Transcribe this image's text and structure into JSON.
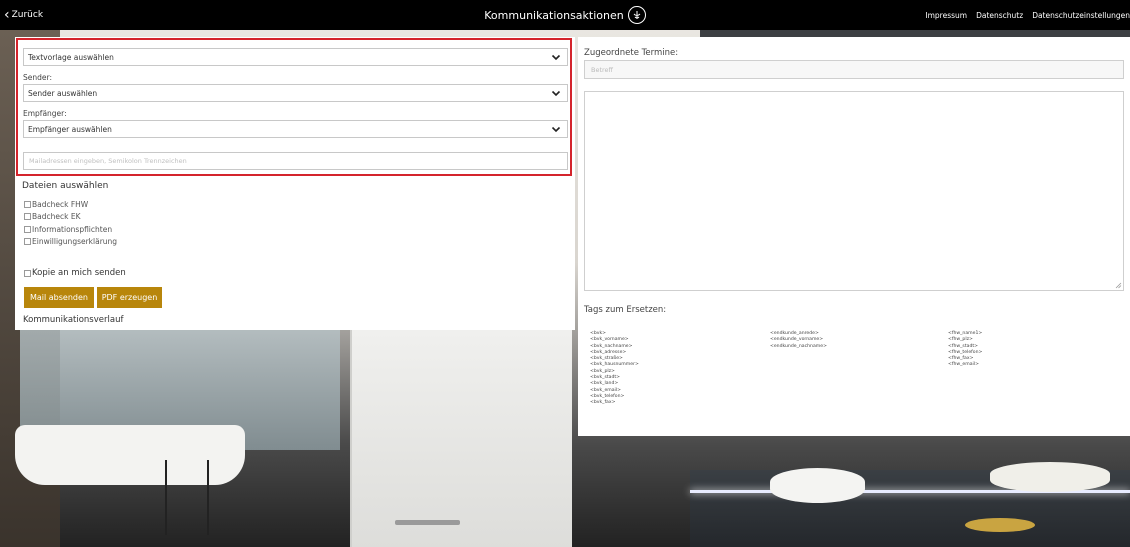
{
  "topbar": {
    "back_label": "Zurück",
    "title": "Kommunikationsaktionen",
    "links": [
      "Impressum",
      "Datenschutz",
      "Datenschutzeinstellungen"
    ]
  },
  "form": {
    "template_select": "Textvorlage auswählen",
    "sender_label": "Sender:",
    "sender_select": "Sender auswählen",
    "recipient_label": "Empfänger:",
    "recipient_select": "Empfänger auswählen",
    "email_placeholder": "Mailadressen eingeben, Semikolon Trennzeichen",
    "files_title": "Dateien auswählen",
    "files": [
      "Badcheck FHW",
      "Badcheck EK",
      "Informationspflichten",
      "Einwilligungserklärung"
    ],
    "copy_label": "Kopie an mich senden",
    "send_button": "Mail absenden",
    "pdf_button": "PDF erzeugen",
    "history_label": "Kommunikationsverlauf"
  },
  "right": {
    "appointments_label": "Zugeordnete Termine:",
    "subject_placeholder": "Betreff",
    "tags_title": "Tags zum Ersetzen:",
    "tags_col1": [
      "<bvk>",
      "<bvk_vorname>",
      "<bvk_nachname>",
      "<bvk_adresse>",
      "<bvk_straße>",
      "<bvk_hausnummer>",
      "<bvk_plz>",
      "<bvk_stadt>",
      "<bvk_land>",
      "<bvk_email>",
      "<bvk_telefon>",
      "<bvk_fax>"
    ],
    "tags_col2": [
      "<endkunde_anrede>",
      "<endkunde_vorname>",
      "<endkunde_nachname>"
    ],
    "tags_col3": [
      "<fhw_name1>",
      "<fhw_plz>",
      "<fhw_stadt>",
      "<fhw_telefon>",
      "<fhw_fax>",
      "<fhw_email>"
    ]
  },
  "colors": {
    "accent_button": "#b8860b",
    "highlight_border": "#d4242c",
    "topbar": "#000000"
  }
}
